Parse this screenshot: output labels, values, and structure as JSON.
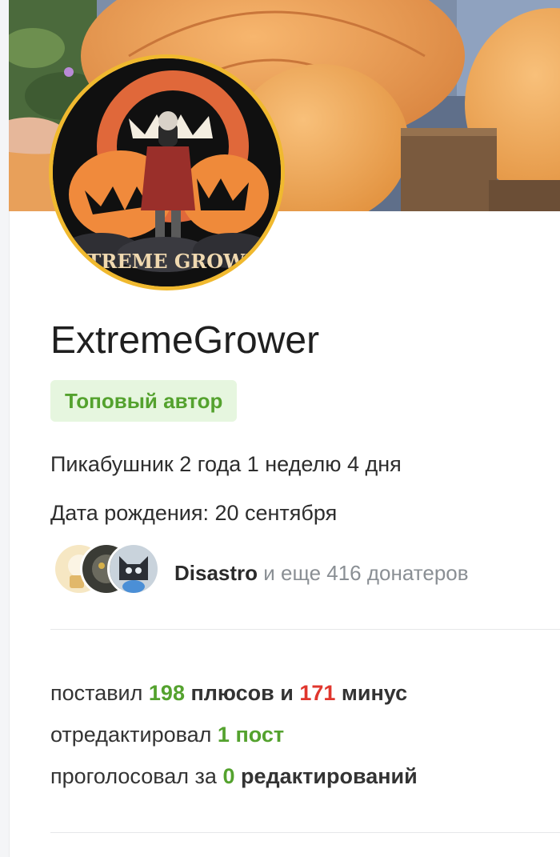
{
  "profile": {
    "username": "ExtremeGrower",
    "badge": "Топовый автор",
    "tenure": "Пикабушник 2 года 1 неделю 4 дня",
    "birthday": "Дата рождения: 20 сентября",
    "avatar_text": "EXTREME GROWER"
  },
  "donors": {
    "top_name": "Disastro",
    "rest_text": " и еще 416 донатеров"
  },
  "stats": {
    "votes_prefix": "поставил ",
    "pluses_count": "198",
    "pluses_word": " плюсов и ",
    "minuses_count": "171",
    "minuses_word": " минус",
    "edited_prefix": "отредактировал ",
    "edited_count": "1 пост",
    "voted_prefix": "проголосовал за ",
    "voted_count": "0",
    "voted_word": " редактирований"
  },
  "colors": {
    "accent_green": "#54a22e",
    "minus_red": "#e0362d",
    "badge_bg": "#e6f6df",
    "avatar_ring": "#f0b92f"
  }
}
